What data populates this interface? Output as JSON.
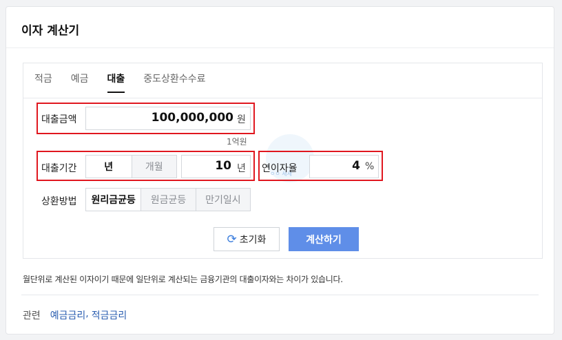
{
  "title": "이자 계산기",
  "tabs": [
    "적금",
    "예금",
    "대출",
    "중도상환수수료"
  ],
  "loan_amount": {
    "label": "대출금액",
    "value": "100,000,000",
    "unit": "원",
    "hint": "1억원"
  },
  "loan_period": {
    "label": "대출기간",
    "toggle_year": "년",
    "toggle_month": "개월",
    "value": "10",
    "unit": "년"
  },
  "interest_rate": {
    "label": "연이자율",
    "value": "4",
    "unit": "%"
  },
  "repayment": {
    "label": "상환방법",
    "options": [
      "원리금균등",
      "원금균등",
      "만기일시"
    ]
  },
  "buttons": {
    "reset": "초기화",
    "calculate": "계산하기"
  },
  "note": "월단위로 계산된 이자이기 때문에 일단위로 계산되는 금융기관의 대출이자와는 차이가 있습니다.",
  "related": {
    "label": "관련",
    "link1": "예금금리",
    "separator": ",",
    "link2": "적금금리"
  },
  "colors": {
    "highlight": "#e0161e",
    "primary": "#5f8ee8",
    "link": "#2a5db0"
  }
}
